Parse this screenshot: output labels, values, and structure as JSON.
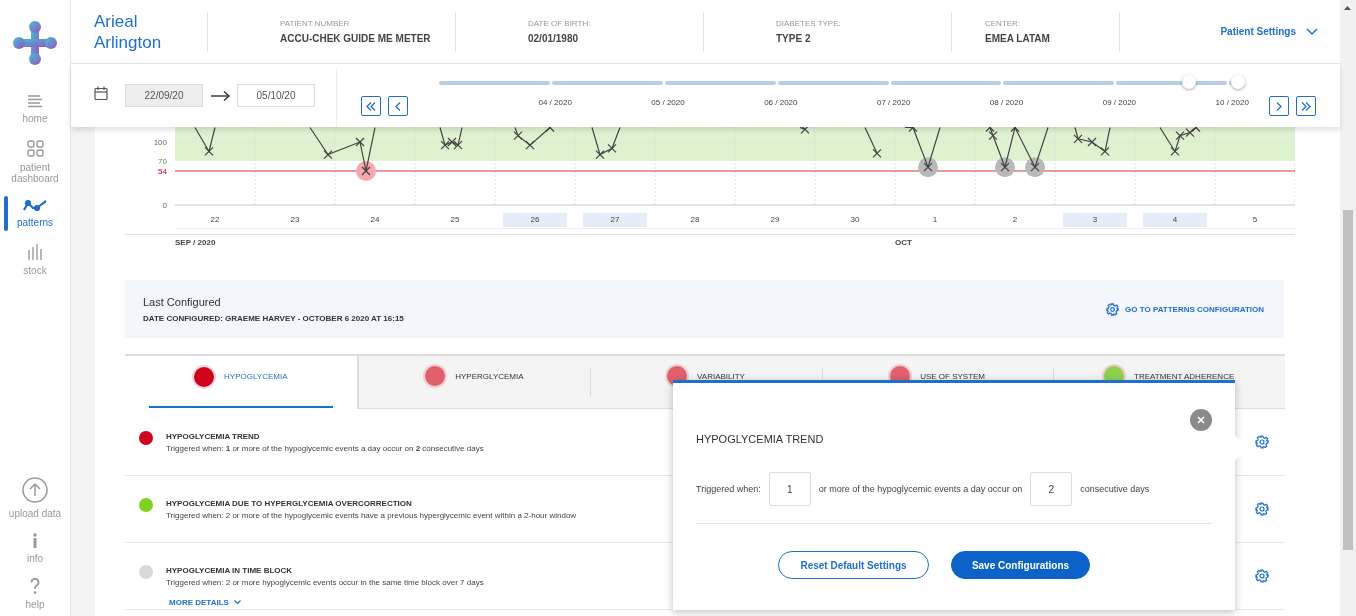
{
  "sidebar": {
    "items": [
      {
        "label": "home",
        "selected": false
      },
      {
        "label": "patient dashboard",
        "selected": false
      },
      {
        "label": "patterns",
        "selected": true
      },
      {
        "label": "stock",
        "selected": false
      }
    ],
    "bottom_items": [
      {
        "label": "upload data"
      },
      {
        "label": "info"
      },
      {
        "label": "help"
      }
    ]
  },
  "header": {
    "patient_name": "Arieal Arlington",
    "fields": [
      {
        "label": "PATIENT NUMBER",
        "value": "ACCU-CHEK GUIDE ME METER"
      },
      {
        "label": "DATE OF BIRTH:",
        "value": "02/01/1980"
      },
      {
        "label": "DIABETES TYPE:",
        "value": "TYPE 2"
      },
      {
        "label": "CENTER:",
        "value": "EMEA LATAM"
      }
    ],
    "settings_menu": "Patient Settings"
  },
  "date_range": {
    "fields": [
      {
        "value": "22/09/20",
        "disabled": true
      },
      {
        "value": "05/10/20",
        "disabled": false
      }
    ]
  },
  "timeline": {
    "months": [
      "04 / 2020",
      "05 / 2020",
      "06 / 2020",
      "07 / 2020",
      "08 / 2020",
      "09 / 2020",
      "10 / 2020"
    ]
  },
  "chart": {
    "y_ticks": [
      {
        "label": "100",
        "kind": "normal"
      },
      {
        "label": "70",
        "kind": "target"
      },
      {
        "label": "54",
        "kind": "hypo"
      },
      {
        "label": "0",
        "kind": "normal"
      }
    ],
    "months": [
      {
        "label": "SEP / 2020",
        "days": [
          {
            "label": "22",
            "highlighted": false
          },
          {
            "label": "23",
            "highlighted": false
          },
          {
            "label": "24",
            "highlighted": false
          },
          {
            "label": "25",
            "highlighted": false
          },
          {
            "label": "26",
            "highlighted": true
          },
          {
            "label": "27",
            "highlighted": true
          },
          {
            "label": "28",
            "highlighted": false
          },
          {
            "label": "29",
            "highlighted": false
          },
          {
            "label": "30",
            "highlighted": false
          }
        ]
      },
      {
        "label": "OCT",
        "days": [
          {
            "label": "1",
            "highlighted": false
          },
          {
            "label": "2",
            "highlighted": false
          },
          {
            "label": "3",
            "highlighted": true
          },
          {
            "label": "4",
            "highlighted": true
          },
          {
            "label": "5",
            "highlighted": false
          }
        ]
      }
    ]
  },
  "last_configured": {
    "title": "Last Configured",
    "detail": "DATE CONFIGURED: GRAEME HARVEY - OCTOBER 6 2020 AT 16:15",
    "link": "GO TO PATTERNS CONFIGURATION"
  },
  "pattern_tabs": [
    {
      "label": "HYPOGLYCEMIA",
      "color": "#d0021b",
      "selected": true
    },
    {
      "label": "HYPERGLYCEMIA",
      "color": "#e0606e",
      "selected": false
    },
    {
      "label": "VARIABILITY",
      "color": "#e0606e",
      "selected": false
    },
    {
      "label": "USE OF SYSTEM",
      "color": "#e0606e",
      "selected": false
    },
    {
      "label": "TREATMENT ADHERENCE",
      "color": "#8fd14f",
      "selected": false
    }
  ],
  "patterns": [
    {
      "title": "HYPOGLYCEMIA TREND",
      "description": "Triggered when: **1** or more of the hypoglycemic events a day occur on **2** consecutive days",
      "color": "#d0021b"
    },
    {
      "title": "HYPOGLYCEMIA DUE TO HYPERGLYCEMIA OVERCORRECTION",
      "description": "Triggered when: 2 or more of the hypoglycemic events have a previous hyperglycemic event within a 2-hour window",
      "color": "#7ed321"
    },
    {
      "title": "HYPOGLYCEMIA IN TIME BLOCK",
      "description": "Triggered when: 2 or more hypoglycemic events occur in the same time block over 7 days",
      "color": "#d8d8d8",
      "more_details": "MORE DETAILS"
    }
  ],
  "popover": {
    "title": "HYPOGLYCEMIA TREND",
    "label": "Triggered when:",
    "count": "1",
    "middle": "or more of the hypoglycemic events a day occur on",
    "days": "2",
    "suffix": "consecutive days",
    "buttons": [
      {
        "label": "Reset Default Settings",
        "kind": "secondary"
      },
      {
        "label": "Save Configurations",
        "kind": "primary"
      }
    ]
  }
}
